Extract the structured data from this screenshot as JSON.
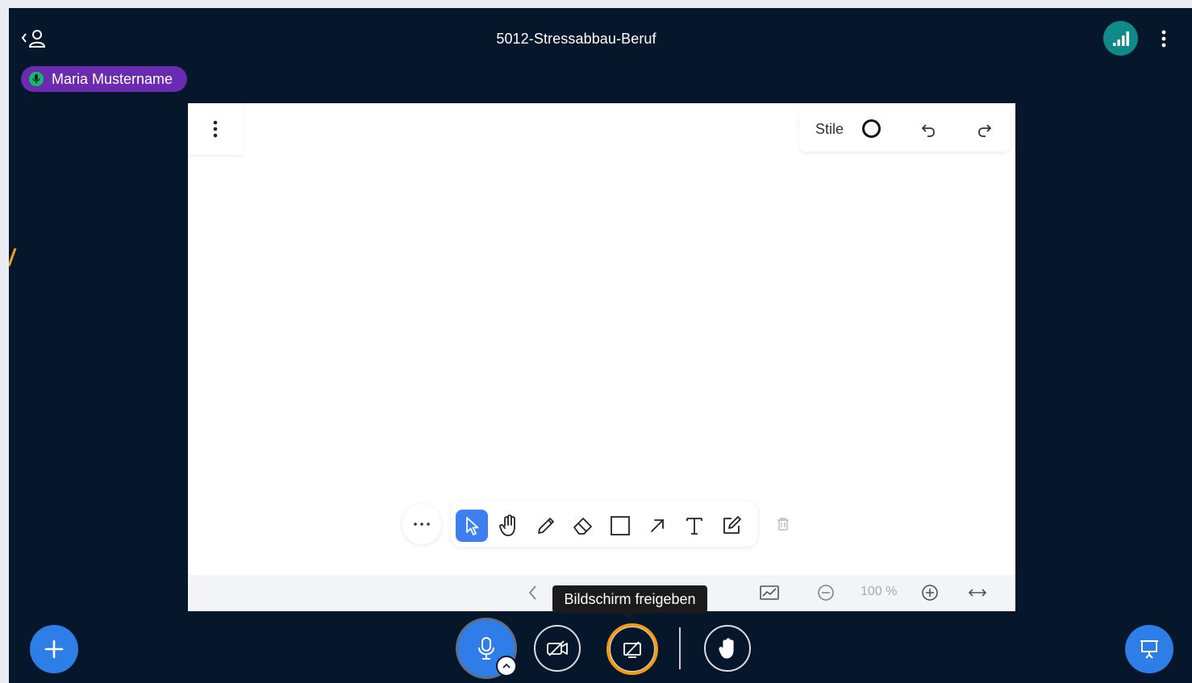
{
  "header": {
    "title": "5012-Stressabbau-Beruf",
    "talker_name": "Maria Mustername"
  },
  "whiteboard": {
    "styles_label": "Stile",
    "zoom_value": "100 %",
    "tools": [
      {
        "name": "select",
        "icon": "pointer-icon",
        "active": true
      },
      {
        "name": "pan",
        "icon": "hand-icon",
        "active": false
      },
      {
        "name": "draw",
        "icon": "pencil-icon",
        "active": false
      },
      {
        "name": "erase",
        "icon": "eraser-icon",
        "active": false
      },
      {
        "name": "rectangle",
        "icon": "rectangle-icon",
        "active": false
      },
      {
        "name": "arrow",
        "icon": "arrow-icon",
        "active": false
      },
      {
        "name": "text",
        "icon": "text-icon",
        "active": false
      },
      {
        "name": "note",
        "icon": "note-edit-icon",
        "active": false
      }
    ]
  },
  "tooltip": {
    "text": "Bildschirm freigeben"
  },
  "colors": {
    "background": "#06172b",
    "accent_blue": "#2f7de8",
    "talker_purple": "#6a2bb0",
    "connection_teal": "#0f8a88",
    "highlight_orange": "#f39a16"
  }
}
